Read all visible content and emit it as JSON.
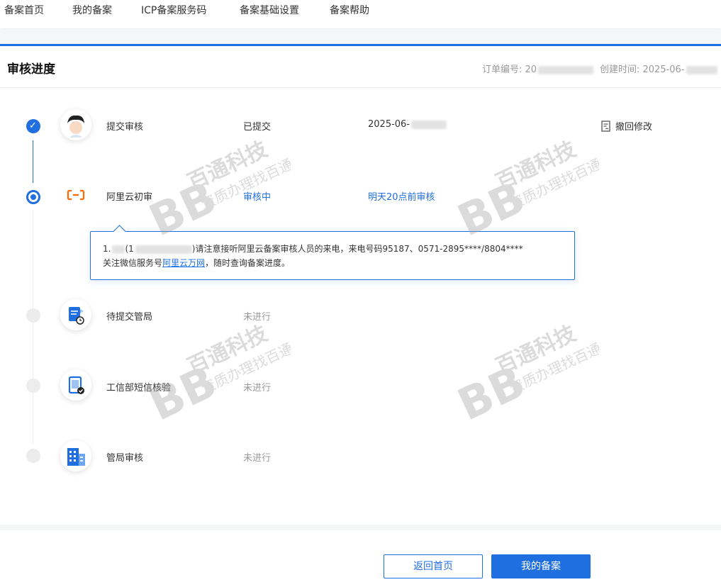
{
  "nav": {
    "items": [
      "备案首页",
      "我的备案",
      "ICP备案服务码",
      "备案基础设置",
      "备案帮助"
    ]
  },
  "header": {
    "title": "审核进度",
    "order_label": "订单编号: 20",
    "created_label": "创建时间: 2025-06-"
  },
  "steps": [
    {
      "label": "提交审核",
      "status": "已提交",
      "extra": "2025-06-",
      "action": "撤回修改",
      "icon": "user-avatar-icon"
    },
    {
      "label": "阿里云初审",
      "status": "审核中",
      "extra": "明天20点前审核",
      "icon": "aliyun-logo-icon"
    },
    {
      "label": "待提交管局",
      "status": "未进行",
      "icon": "document-clock-icon"
    },
    {
      "label": "工信部短信核验",
      "status": "未进行",
      "icon": "phone-check-icon"
    },
    {
      "label": "管局审核",
      "status": "未进行",
      "icon": "building-icon"
    }
  ],
  "tip": {
    "line1_prefix": "1.",
    "line1_mid": "(1",
    "line1_text": ")请注意接听阿里云备案审核人员的来电，来电号码95187、0571-2895****/8804****",
    "line2_prefix": "关注微信服务号",
    "line2_link": "阿里云万网",
    "line2_suffix": "，随时查询备案进度。"
  },
  "watermark": {
    "line1": "百通科技",
    "line2": "资质办理找百通",
    "mark": "BB"
  },
  "footer": {
    "back_label": "返回首页",
    "mine_label": "我的备案"
  },
  "colors": {
    "accent": "#1f6fe0",
    "pending": "#ececec",
    "muted": "#999999"
  }
}
